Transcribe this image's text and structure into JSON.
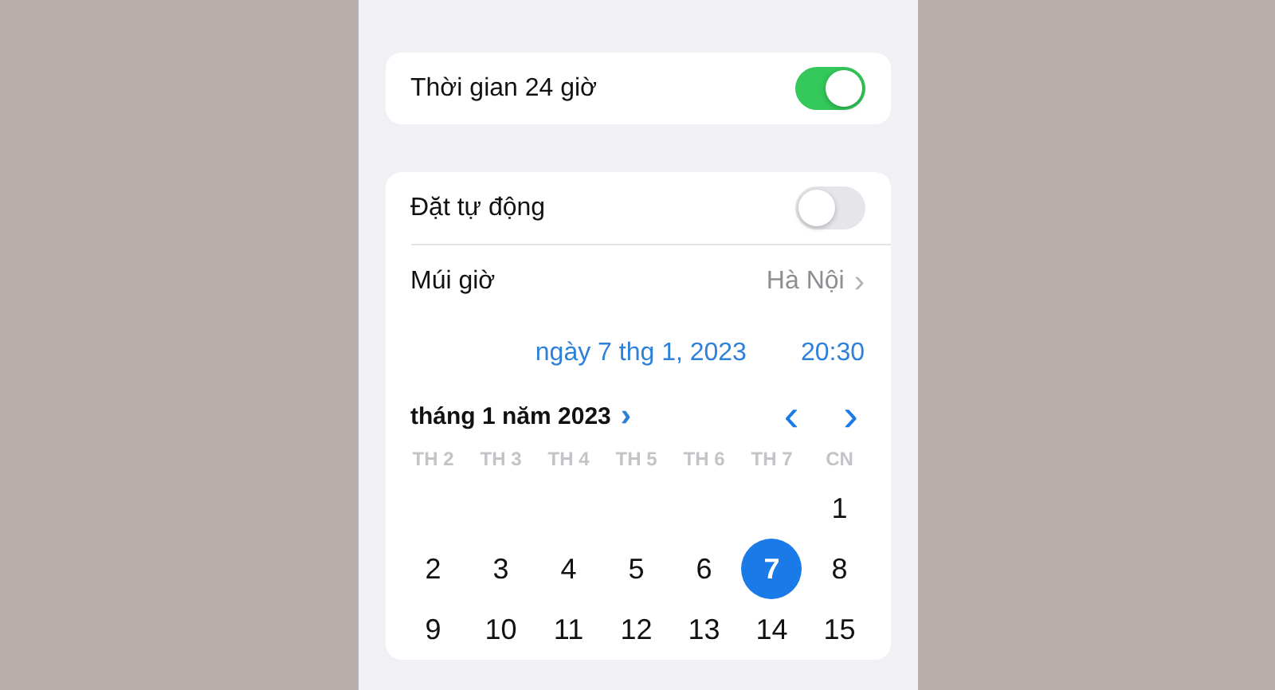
{
  "time_24h": {
    "label": "Thời gian 24 giờ",
    "on": true
  },
  "auto_set": {
    "label": "Đặt tự động",
    "on": false
  },
  "time_zone": {
    "label": "Múi giờ",
    "value": "Hà Nội",
    "chevron": "›"
  },
  "date_time": {
    "date": "ngày 7 thg 1, 2023",
    "time": "20:30"
  },
  "calendar": {
    "month_title": "tháng 1 năm 2023",
    "month_chevron": "›",
    "prev": "‹",
    "next": "›",
    "weekdays": [
      "TH 2",
      "TH 3",
      "TH 4",
      "TH 5",
      "TH 6",
      "TH 7",
      "CN"
    ],
    "weeks": [
      [
        {
          "day": "1",
          "selected": false
        }
      ],
      [
        {
          "day": "2",
          "selected": false
        },
        {
          "day": "3",
          "selected": false
        },
        {
          "day": "4",
          "selected": false
        },
        {
          "day": "5",
          "selected": false
        },
        {
          "day": "6",
          "selected": false
        },
        {
          "day": "7",
          "selected": true
        },
        {
          "day": "8",
          "selected": false
        }
      ],
      [
        {
          "day": "9",
          "selected": false
        },
        {
          "day": "10",
          "selected": false
        },
        {
          "day": "11",
          "selected": false
        },
        {
          "day": "12",
          "selected": false
        },
        {
          "day": "13",
          "selected": false
        },
        {
          "day": "14",
          "selected": false
        },
        {
          "day": "15",
          "selected": false
        }
      ]
    ]
  }
}
